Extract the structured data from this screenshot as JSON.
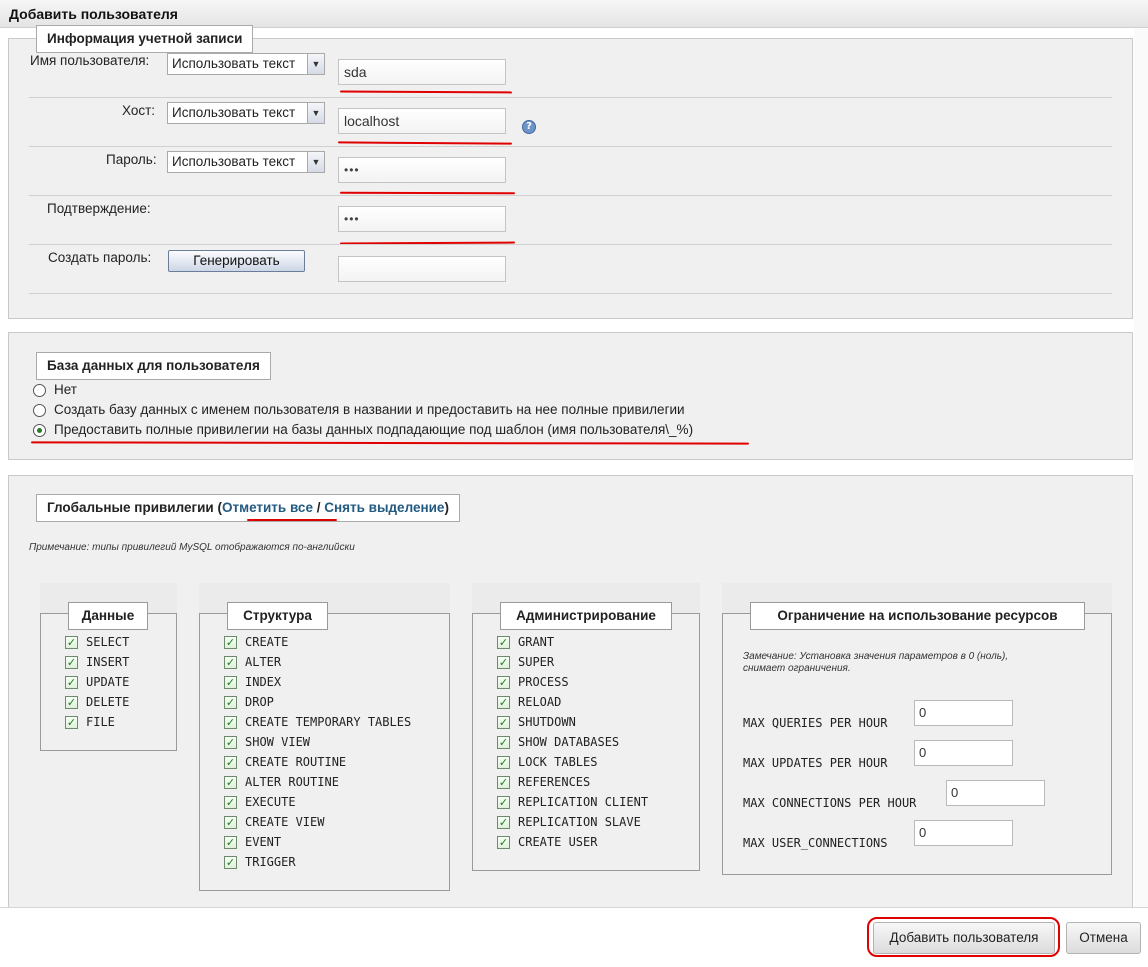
{
  "dialog": {
    "title": "Добавить пользователя"
  },
  "account": {
    "legend": "Информация учетной записи",
    "rows": [
      {
        "label": "Имя пользователя:",
        "select": "Использовать текст",
        "value": "sda"
      },
      {
        "label": "Хост:",
        "select": "Использовать текст",
        "value": "localhost"
      },
      {
        "label": "Пароль:",
        "select": "Использовать текст",
        "value": "•••"
      },
      {
        "label": "Подтверждение:",
        "value": "•••"
      },
      {
        "label": "Создать пароль:",
        "button": "Генерировать",
        "value": ""
      }
    ]
  },
  "database": {
    "legend": "База данных для пользователя",
    "options": [
      {
        "label": "Нет",
        "selected": false
      },
      {
        "label": "Создать базу данных с именем пользователя в названии и предоставить на нее полные привилегии",
        "selected": false
      },
      {
        "label": "Предоставить полные привилегии на базы данных подпадающие под шаблон (имя пользователя\\_%)",
        "selected": true
      }
    ]
  },
  "global": {
    "legend_prefix": "Глобальные привилегии (",
    "check_all": "Отметить все",
    "separator": " / ",
    "uncheck_all": "Снять выделение",
    "legend_suffix": ")",
    "note": "Примечание: типы привилегий MySQL отображаются по-английски",
    "groups": [
      {
        "title": "Данные",
        "items": [
          "SELECT",
          "INSERT",
          "UPDATE",
          "DELETE",
          "FILE"
        ]
      },
      {
        "title": "Структура",
        "items": [
          "CREATE",
          "ALTER",
          "INDEX",
          "DROP",
          "CREATE TEMPORARY TABLES",
          "SHOW VIEW",
          "CREATE ROUTINE",
          "ALTER ROUTINE",
          "EXECUTE",
          "CREATE VIEW",
          "EVENT",
          "TRIGGER"
        ]
      },
      {
        "title": "Администрирование",
        "items": [
          "GRANT",
          "SUPER",
          "PROCESS",
          "RELOAD",
          "SHUTDOWN",
          "SHOW DATABASES",
          "LOCK TABLES",
          "REFERENCES",
          "REPLICATION CLIENT",
          "REPLICATION SLAVE",
          "CREATE USER"
        ]
      }
    ],
    "resources": {
      "title": "Ограничение на использование ресурсов",
      "note_line1": "Замечание: Установка значения параметров в 0 (ноль),",
      "note_line2": "снимает ограничения.",
      "limits": [
        {
          "label": "MAX QUERIES PER HOUR",
          "value": "0"
        },
        {
          "label": "MAX UPDATES PER HOUR",
          "value": "0"
        },
        {
          "label": "MAX CONNECTIONS PER HOUR",
          "value": "0"
        },
        {
          "label": "MAX USER_CONNECTIONS",
          "value": "0"
        }
      ]
    }
  },
  "footer": {
    "add_button": "Добавить пользователя",
    "cancel_button": "Отмена"
  },
  "colors": {
    "annotation": "#e00000",
    "link": "#235a81",
    "checkbox": "#1d7a1d"
  },
  "icons": {
    "help": "help-icon",
    "checkbox": "checkmark"
  }
}
